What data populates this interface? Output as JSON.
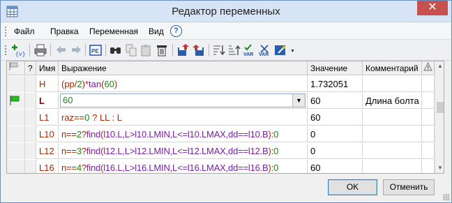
{
  "window": {
    "title": "Редактор переменных",
    "close": "✕"
  },
  "menu": {
    "items": [
      "Файл",
      "Правка",
      "Переменная",
      "Вид"
    ],
    "help": "?"
  },
  "toolbar": {
    "icons": [
      "add-variable-icon",
      "print-icon",
      "undo-icon",
      "redo-icon",
      "properties-icon",
      "find-icon",
      "copy-icon",
      "paste-icon",
      "delete-icon",
      "import-icon",
      "export-icon",
      "sort-down-icon",
      "sort-up-icon",
      "check-variable-icon",
      "check-var-icon",
      "wizard-icon"
    ]
  },
  "grid": {
    "headers": {
      "q": "?",
      "name": "Имя",
      "expr": "Выражение",
      "value": "Значение",
      "comment": "Комментарий",
      "warn": "!"
    },
    "rows": [
      {
        "name": "H",
        "expr": "(pp/2)*tan(60)",
        "value": "1.732051",
        "comment": ""
      },
      {
        "name": "L",
        "expr": "60",
        "value": "60",
        "comment": "Длина болта"
      },
      {
        "name": "L1",
        "expr": "raz==0 ? LL : L",
        "value": "60",
        "comment": ""
      },
      {
        "name": "L10",
        "expr": "n==2?find(l10.L,L>l10.LMIN,L<=l10.LMAX,dd==l10.B):0",
        "value": "0",
        "comment": ""
      },
      {
        "name": "L12",
        "expr": "n==3?find(l12.L,L>l12.LMIN,L<=l12.LMAX,dd==l12.B):0",
        "value": "0",
        "comment": ""
      },
      {
        "name": "L16",
        "expr": "n==4?find(l16.L,L>l16.LMIN,L<=l16.LMAX,dd==l16.B):0",
        "value": "60",
        "comment": ""
      }
    ]
  },
  "buttons": {
    "ok": "OK",
    "cancel": "Отменить"
  },
  "colors": {
    "accent": "#3c7fb1",
    "function": "#7a1fa2",
    "number": "#1a8a1a",
    "name": "#a52a00",
    "close": "#c75050"
  }
}
